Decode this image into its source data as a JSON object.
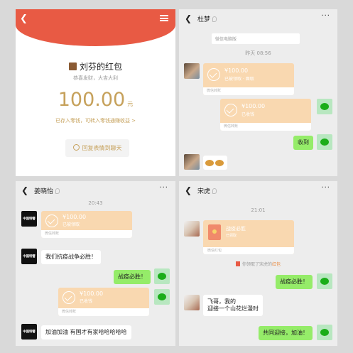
{
  "red_packet_detail": {
    "sender": "刘芬的红包",
    "wish": "恭喜发财，大吉大利",
    "amount": "100.00",
    "unit": "元",
    "note": "已存入零钱，可转入零钱通赚收益 >",
    "reply_label": "回复表情到聊天"
  },
  "chat_dumeng": {
    "title": "杜梦",
    "more": "···",
    "system": "微信电脑版",
    "time": "昨天 08:56",
    "transfer1": {
      "amount": "¥100.00",
      "status": "已被领取 · 面取",
      "footer": "微信转账"
    },
    "transfer2": {
      "amount": "¥100.00",
      "status": "已收钱",
      "footer": "微信转账"
    },
    "reply": "收到"
  },
  "chat_jiang": {
    "title": "姜晓怡",
    "more": "···",
    "time": "20:43",
    "transfer1": {
      "amount": "¥100.00",
      "status": "已被领取",
      "footer": "微信转账"
    },
    "msg1": "我们抗疫战争必胜！",
    "reply1": "战疫必胜！",
    "transfer2": {
      "amount": "¥100.00",
      "status": "已收钱",
      "footer": "微信转账"
    },
    "msg2": "加油加油 有国才有家哈哈哈哈哈",
    "avatar_text": "中国特警"
  },
  "chat_songhu": {
    "title": "宋虎",
    "more": "···",
    "time": "21:01",
    "red_packet": {
      "name": "战疫必胜",
      "status": "已领取",
      "footer": "微信红包"
    },
    "claim_prefix": "你领取了宋虎的",
    "claim_highlight": "红包",
    "reply1": "战疫必胜！",
    "msg1": "飞哥，我的",
    "msg2": "迎接一个山花烂漫时",
    "reply2": "共同迎接，加油！"
  }
}
